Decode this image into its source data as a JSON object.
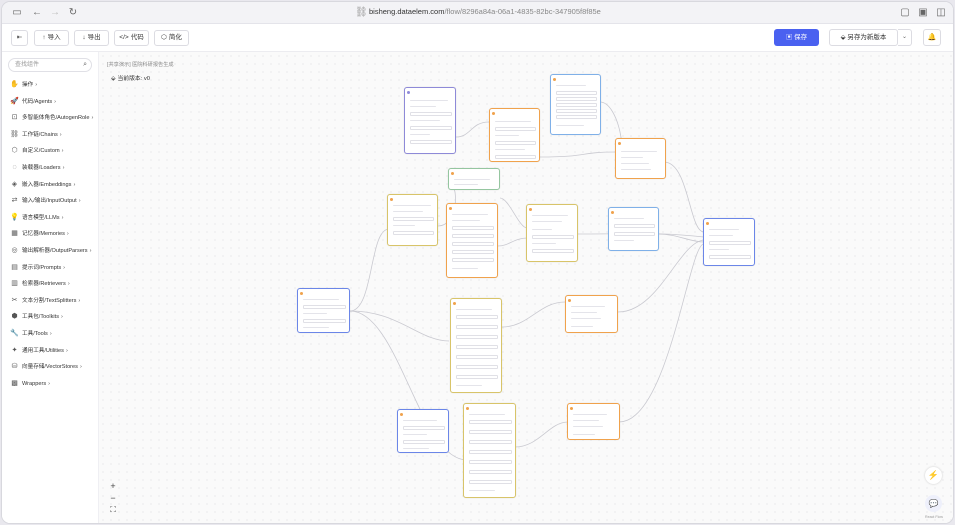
{
  "browser": {
    "url_host": "bisheng.dataelem.com",
    "url_path": "/flow/8296a84a-06a1-4835-82bc-347905f8f85e"
  },
  "toolbar": {
    "import_label": "导入",
    "export_label": "导出",
    "code_label": "代码",
    "simplify_label": "简化",
    "save_label": "保存",
    "save_as_label": "另存为新版本"
  },
  "sidebar": {
    "search_placeholder": "查找组件",
    "items": [
      {
        "label": "操作",
        "icon": "hand-icon"
      },
      {
        "label": "代码/Agents",
        "icon": "rocket-icon"
      },
      {
        "label": "多智能体角色/AutogenRole",
        "icon": "bot-icon"
      },
      {
        "label": "工作链/Chains",
        "icon": "link-icon"
      },
      {
        "label": "自定义/Custom",
        "icon": "box-icon"
      },
      {
        "label": "装载器/Loaders",
        "icon": "loader-icon"
      },
      {
        "label": "嵌入器/Embeddings",
        "icon": "layers-icon"
      },
      {
        "label": "输入/输出/InputOutput",
        "icon": "io-icon"
      },
      {
        "label": "语言模型/LLMs",
        "icon": "bulb-icon"
      },
      {
        "label": "记忆器/Memories",
        "icon": "cpu-icon"
      },
      {
        "label": "输出解析器/OutputParsers",
        "icon": "compass-icon"
      },
      {
        "label": "提示词/Prompts",
        "icon": "terminal-icon"
      },
      {
        "label": "检索器/Retrievers",
        "icon": "file-search-icon"
      },
      {
        "label": "文本分割/TextSplitters",
        "icon": "scissors-icon"
      },
      {
        "label": "工具包/Toolkits",
        "icon": "package-icon"
      },
      {
        "label": "工具/Tools",
        "icon": "wrench-icon"
      },
      {
        "label": "通用工具/Utilities",
        "icon": "wand-icon"
      },
      {
        "label": "向量存储/VectorStores",
        "icon": "database-icon"
      },
      {
        "label": "Wrappers",
        "icon": "gift-icon"
      }
    ]
  },
  "canvas": {
    "breadcrumb": "[共享演示] 医院科研报告生成",
    "version_label": "当前版本: v0",
    "attribution": "React Flow"
  },
  "colors": {
    "accent": "#4a61f0",
    "node_blue": "#6b86e8",
    "node_orange": "#f0a24c",
    "node_green": "#95c6a0",
    "node_yellow": "#d8c469"
  }
}
